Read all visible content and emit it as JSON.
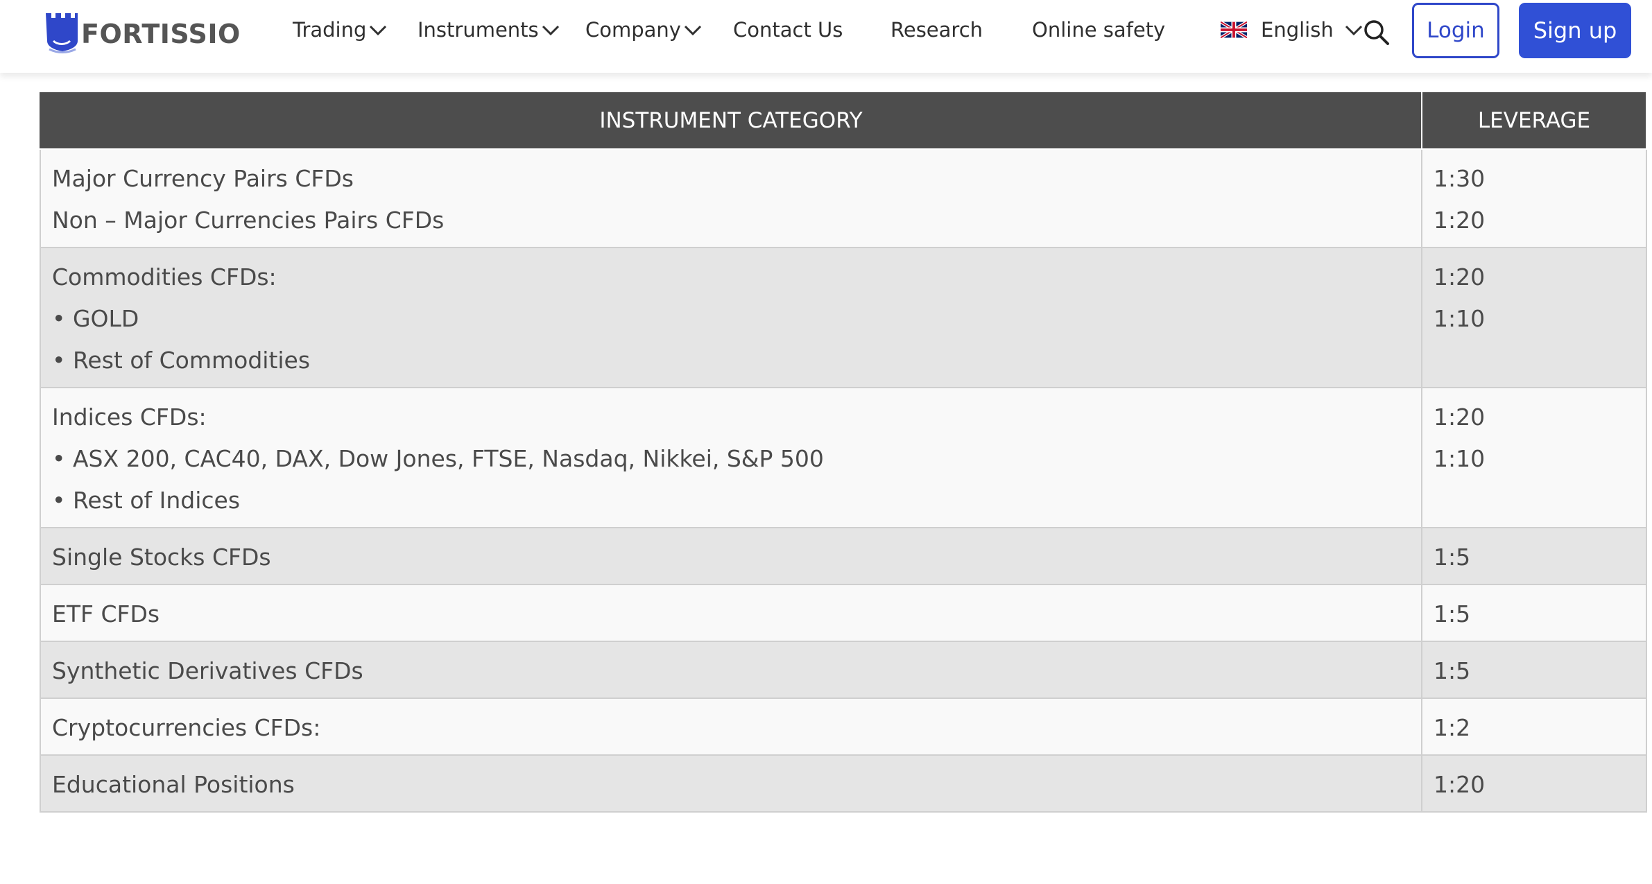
{
  "brand": {
    "name": "FORTISSIO"
  },
  "nav": {
    "items": [
      {
        "label": "Trading",
        "dropdown": true
      },
      {
        "label": "Instruments",
        "dropdown": true
      },
      {
        "label": "Company",
        "dropdown": true
      },
      {
        "label": "Contact Us",
        "dropdown": false
      },
      {
        "label": "Research",
        "dropdown": false
      },
      {
        "label": "Online safety",
        "dropdown": false
      }
    ],
    "language": {
      "label": "English",
      "flag": "uk-flag-icon"
    },
    "search_icon": "search-icon",
    "login_label": "Login",
    "signup_label": "Sign up"
  },
  "colors": {
    "brand_blue": "#3050d6",
    "header_bg": "#4d4d4d",
    "row_light": "#f9f9f9",
    "row_dark": "#e5e5e5"
  },
  "table": {
    "headers": [
      "INSTRUMENT CATEGORY",
      "LEVERAGE"
    ],
    "rows": [
      {
        "category": [
          "Major Currency Pairs CFDs",
          "Non – Major Currencies Pairs CFDs"
        ],
        "leverage": [
          "1:30",
          "1:20"
        ]
      },
      {
        "category": [
          "Commodities CFDs:",
          "• GOLD",
          "• Rest of Commodities"
        ],
        "leverage": [
          "1:20",
          "1:10"
        ]
      },
      {
        "category": [
          "Indices CFDs:",
          "• ASX 200, CAC40, DAX, Dow Jones, FTSE, Nasdaq, Nikkei, S&P 500",
          "• Rest of Indices"
        ],
        "leverage": [
          "1:20",
          "1:10"
        ]
      },
      {
        "category": [
          "Single Stocks CFDs"
        ],
        "leverage": [
          "1:5"
        ]
      },
      {
        "category": [
          "ETF CFDs"
        ],
        "leverage": [
          "1:5"
        ]
      },
      {
        "category": [
          "Synthetic Derivatives CFDs"
        ],
        "leverage": [
          "1:5"
        ]
      },
      {
        "category": [
          "Cryptocurrencies CFDs:"
        ],
        "leverage": [
          "1:2"
        ]
      },
      {
        "category": [
          "Educational Positions"
        ],
        "leverage": [
          "1:20"
        ]
      }
    ]
  }
}
